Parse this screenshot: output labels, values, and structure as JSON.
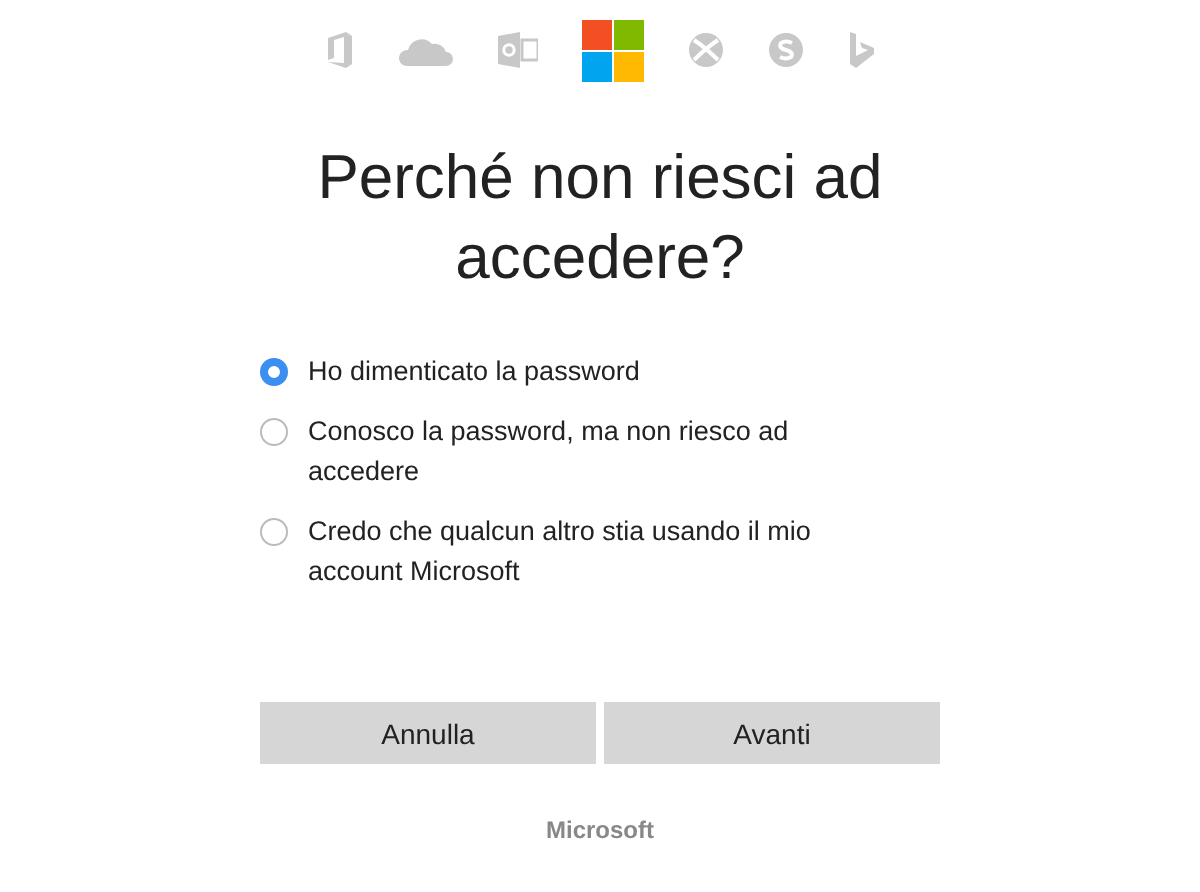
{
  "title": "Perché non riesci ad accedere?",
  "options": [
    {
      "label": "Ho dimenticato la password",
      "selected": true
    },
    {
      "label": "Conosco la password, ma non riesco ad accedere",
      "selected": false
    },
    {
      "label": "Credo che qualcun altro stia usando il mio account Microsoft",
      "selected": false
    }
  ],
  "buttons": [
    "Annulla",
    "Avanti"
  ],
  "footer": "Microsoft"
}
